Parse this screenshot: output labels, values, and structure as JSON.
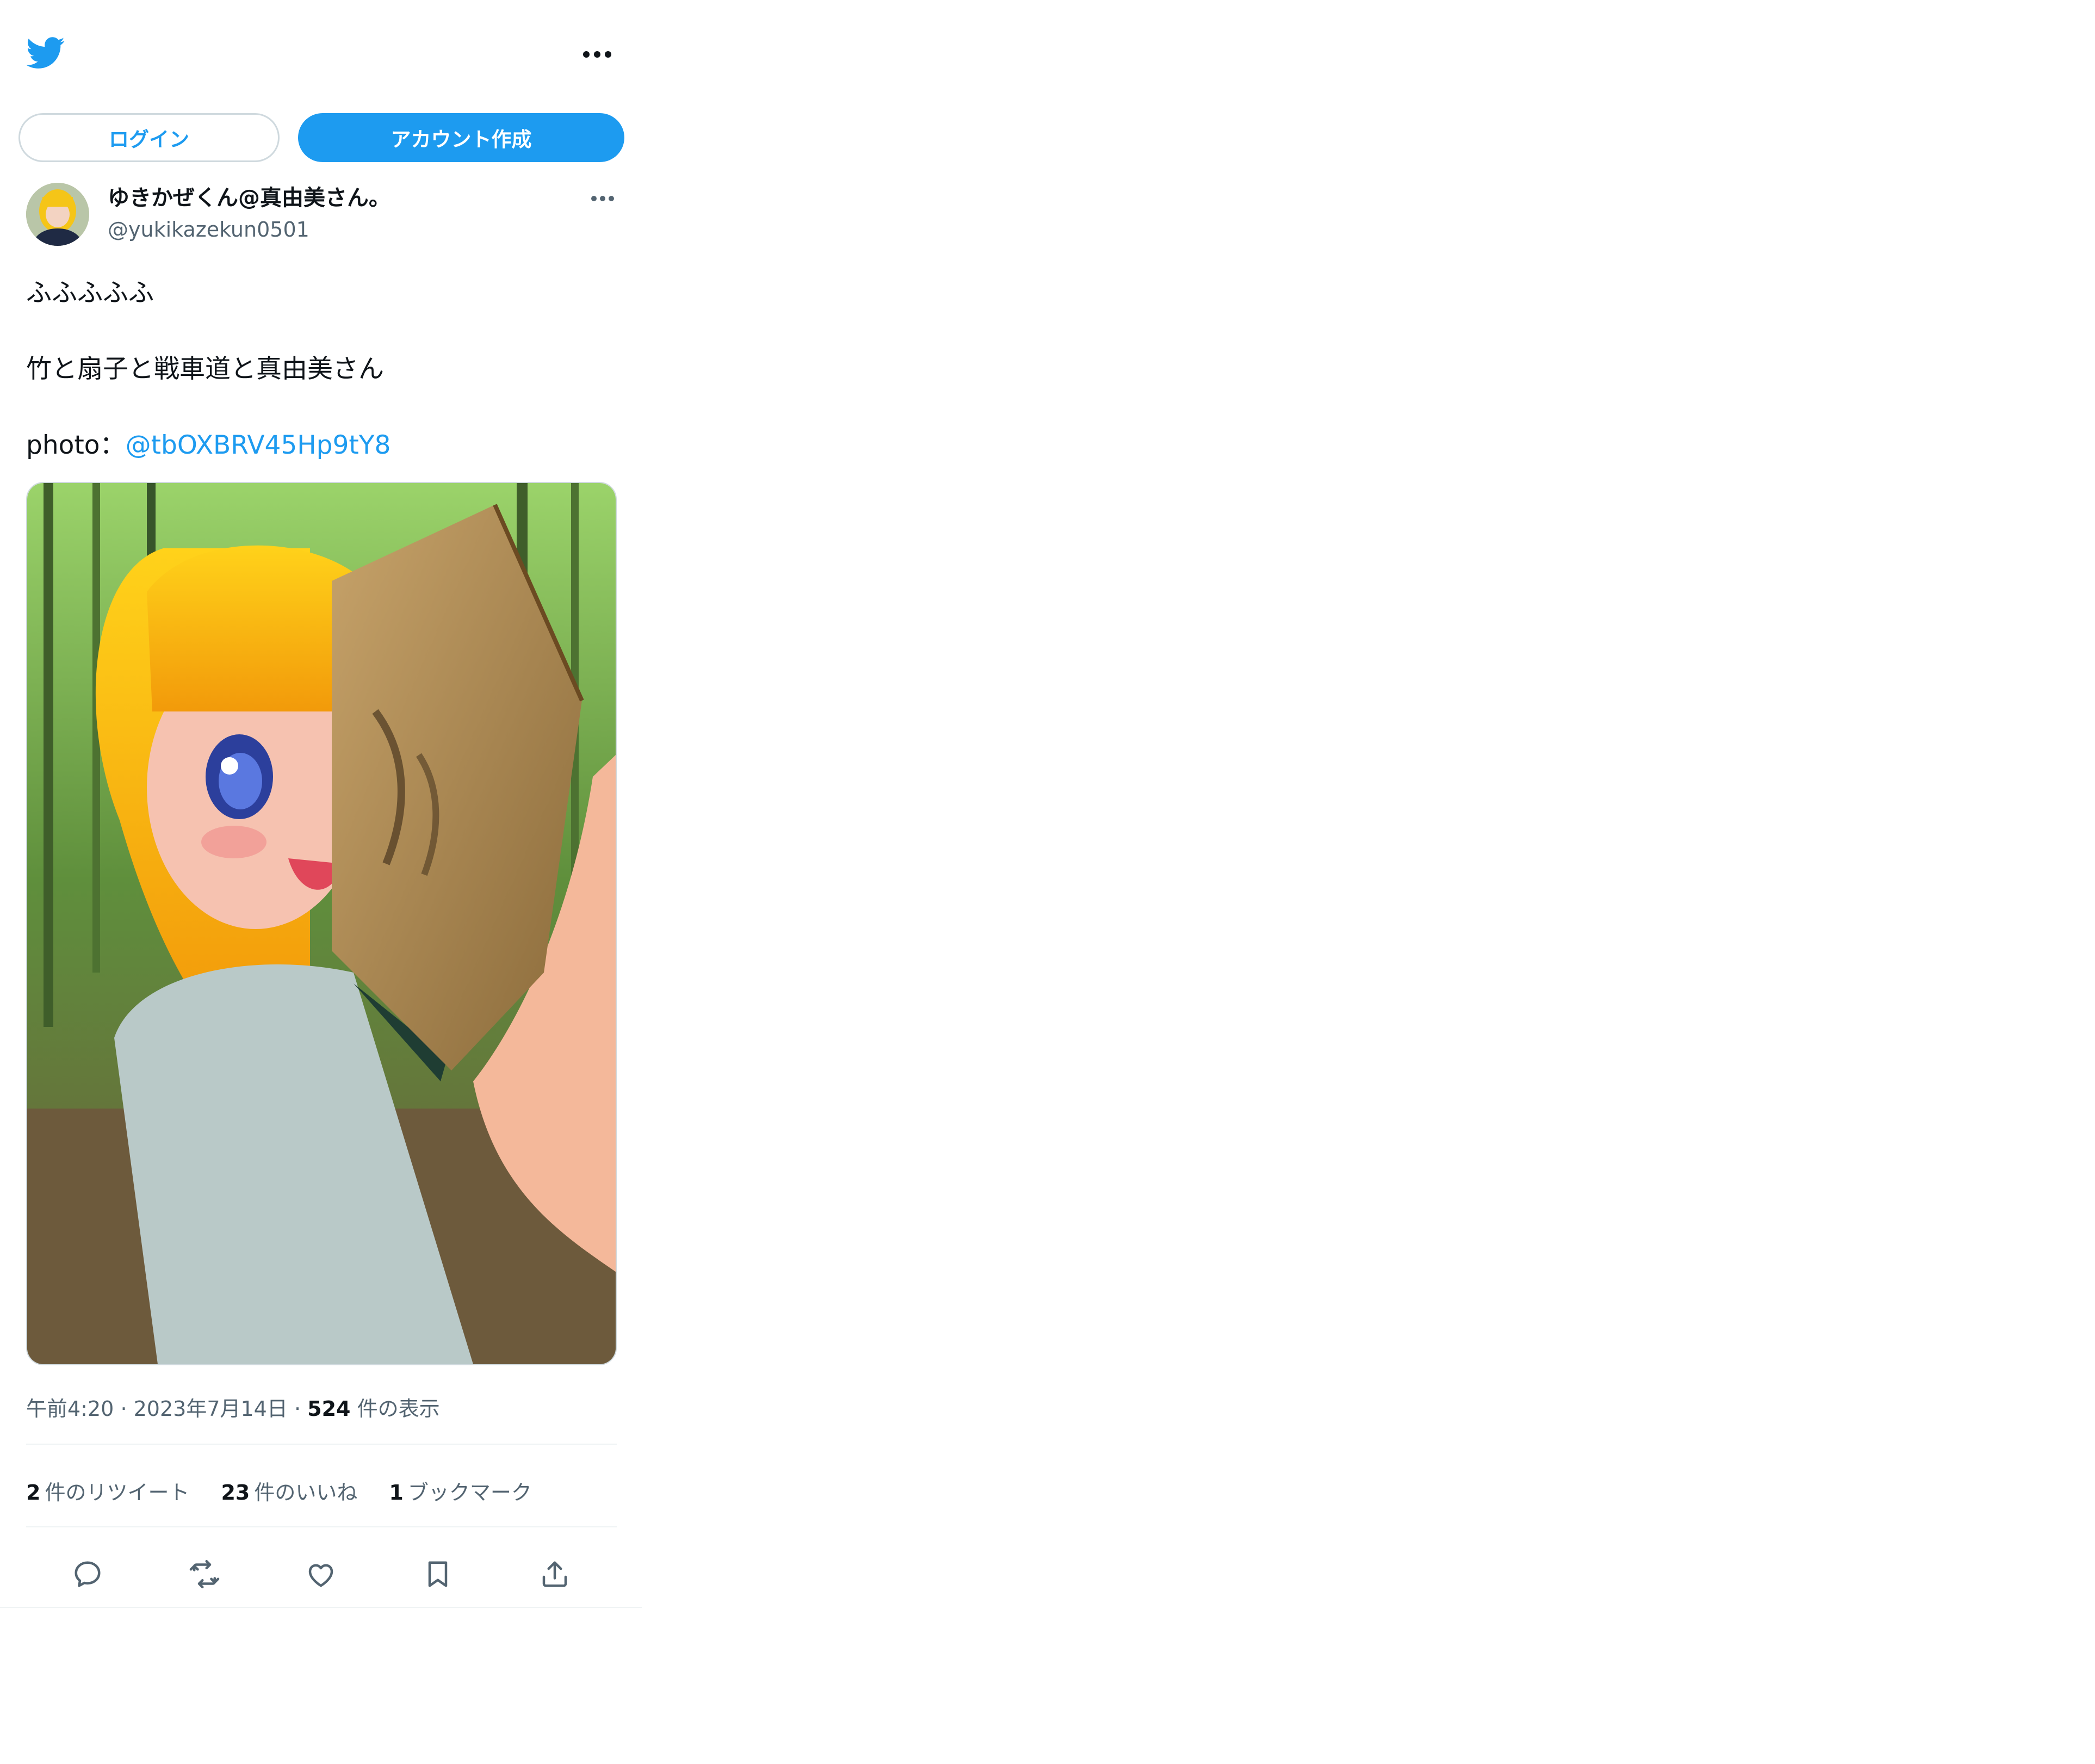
{
  "colors": {
    "accent": "#1d9bf0",
    "text_primary": "#0f1419",
    "text_secondary": "#536471",
    "border": "#cfd9de"
  },
  "topbar": {
    "logo_icon": "twitter-bird-icon",
    "more_icon": "more-horizontal-icon"
  },
  "auth": {
    "login_label": "ログイン",
    "signup_label": "アカウント作成"
  },
  "tweet": {
    "author": {
      "display_name": "ゆきかぜくん@真由美さん。",
      "handle": "@yukikazekun0501",
      "avatar_icon": "avatar"
    },
    "text_lines": {
      "line1": "ふふふふふ",
      "line2": "竹と扇子と戦車道と真由美さん",
      "line3_prefix": "photo：",
      "line3_mention": "@tbOXBRV45Hp9tY8"
    },
    "time": "午前4:20",
    "date": "2023年7月14日",
    "separator": "·",
    "views_count": "524",
    "views_label": "件の表示",
    "stats": {
      "retweets_count": "2",
      "retweets_label": "件のリツイート",
      "likes_count": "23",
      "likes_label": "件のいいね",
      "bookmarks_count": "1",
      "bookmarks_label": "ブックマーク"
    },
    "actions": [
      "reply-icon",
      "retweet-icon",
      "like-icon",
      "bookmark-icon",
      "share-icon"
    ]
  }
}
